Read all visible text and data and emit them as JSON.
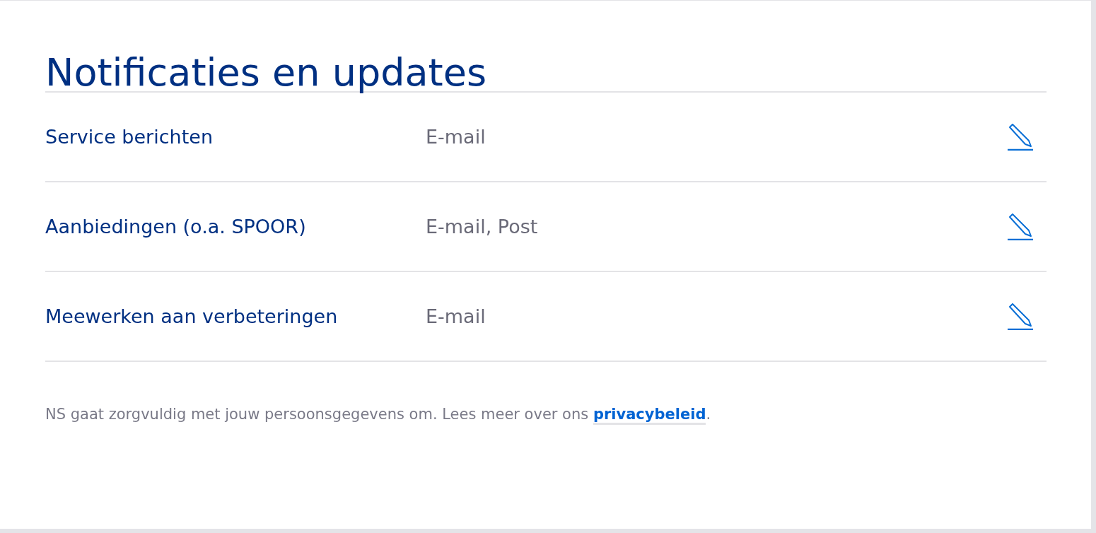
{
  "title": "Notificaties en updates",
  "rows": [
    {
      "label": "Service berichten",
      "value": "E-mail"
    },
    {
      "label": "Aanbiedingen (o.a. SPOOR)",
      "value": "E-mail, Post"
    },
    {
      "label": "Meewerken aan verbeteringen",
      "value": "E-mail"
    }
  ],
  "footer": {
    "text": "NS gaat zorgvuldig met jouw persoonsgegevens om. Lees meer over ons ",
    "link": "privacybeleid",
    "after": "."
  }
}
